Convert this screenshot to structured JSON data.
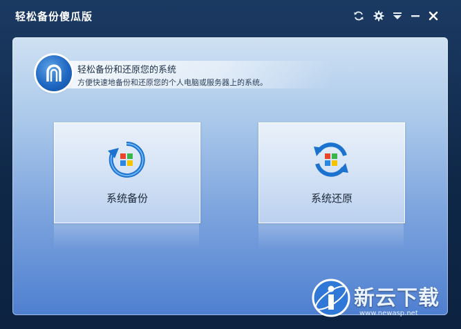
{
  "window": {
    "title": "轻松备份傻瓜版",
    "controls": {
      "refresh_icon": "refresh-icon",
      "settings_icon": "gear-icon",
      "menu_icon": "dropdown-menu-icon",
      "minimize_icon": "minimize-icon",
      "close_icon": "close-icon"
    }
  },
  "header": {
    "title": "轻松备份和还原您的系统",
    "subtitle": "方便快速地备份和还原您的个人电脑或服务器上的系统。"
  },
  "actions": [
    {
      "label": "系统备份",
      "icon": "backup-icon"
    },
    {
      "label": "系统还原",
      "icon": "restore-icon"
    }
  ],
  "watermark": {
    "brand": "新云下载",
    "url": "www.newasp.net"
  },
  "colors": {
    "window_bg": "#0f2848",
    "accent_blue": "#1f68c3",
    "panel_top": "#cfe1f3",
    "panel_bottom": "#4e7fd0"
  }
}
